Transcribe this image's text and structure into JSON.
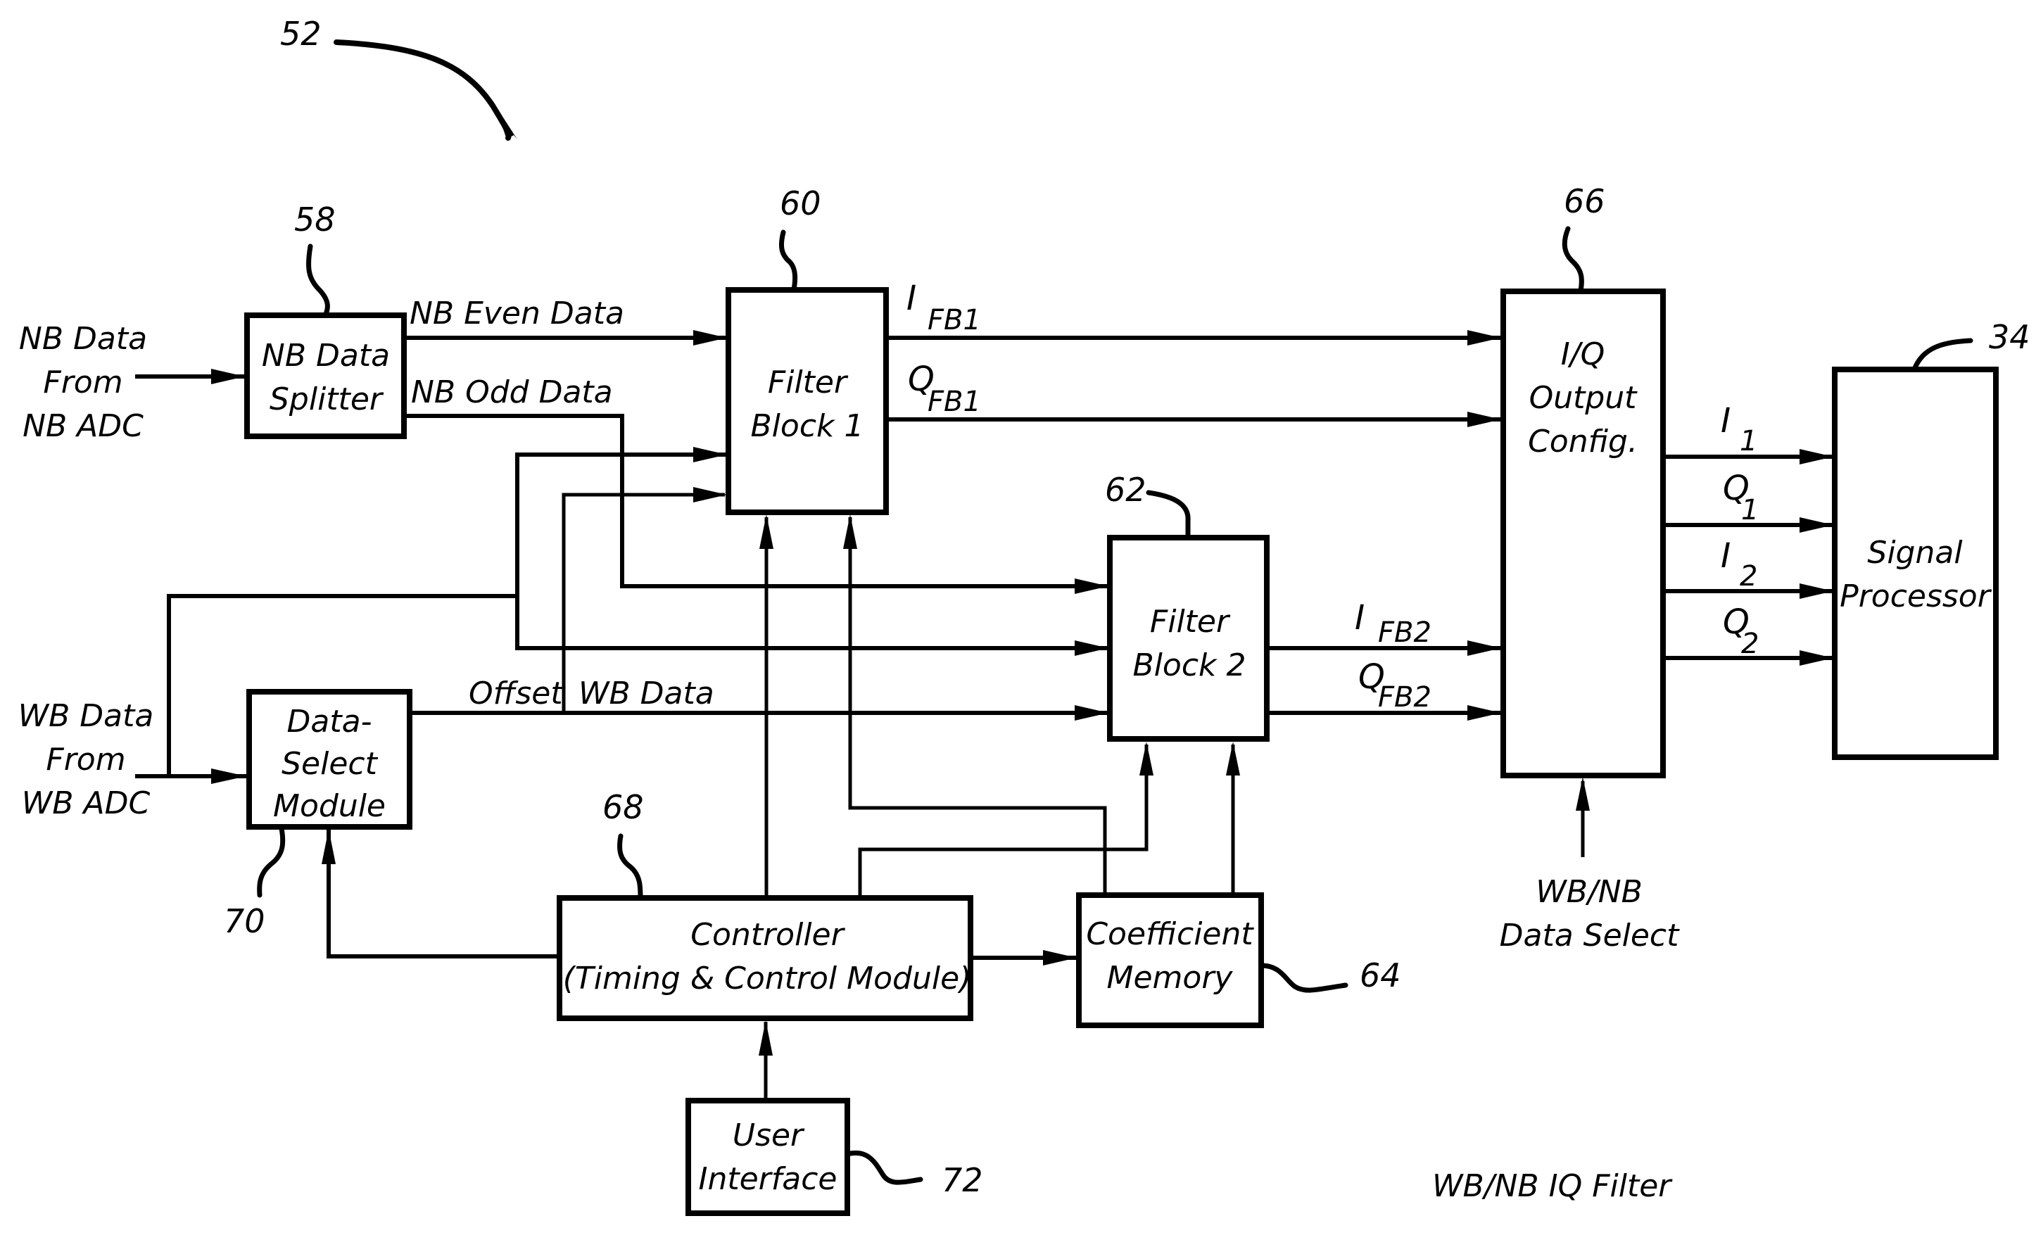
{
  "figure": {
    "reference_number": "52",
    "caption": "WB/NB IQ Filter"
  },
  "inputs": {
    "nb": {
      "lines": [
        "NB Data",
        "From",
        "NB ADC"
      ]
    },
    "wb": {
      "lines": [
        "WB Data",
        "From",
        "WB ADC"
      ]
    },
    "wbnb_select": {
      "lines": [
        "WB/NB",
        "Data Select"
      ]
    }
  },
  "blocks": {
    "nb_splitter": {
      "ref": "58",
      "lines": [
        "NB Data",
        "Splitter"
      ]
    },
    "filter_block_1": {
      "ref": "60",
      "lines": [
        "Filter",
        "Block 1"
      ]
    },
    "filter_block_2": {
      "ref": "62",
      "lines": [
        "Filter",
        "Block 2"
      ]
    },
    "coefficient_memory": {
      "ref": "64",
      "lines": [
        "Coefficient",
        "Memory"
      ]
    },
    "iq_output_config": {
      "ref": "66",
      "lines": [
        "I/Q",
        "Output",
        "Config."
      ]
    },
    "controller": {
      "ref": "68",
      "lines": [
        "Controller",
        "(Timing & Control Module)"
      ]
    },
    "data_select_module": {
      "ref": "70",
      "lines": [
        "Data-",
        "Select",
        "Module"
      ]
    },
    "user_interface": {
      "ref": "72",
      "lines": [
        "User",
        "Interface"
      ]
    },
    "signal_processor": {
      "ref": "34",
      "lines": [
        "Signal",
        "Processor"
      ]
    }
  },
  "signals": {
    "nb_even": "NB Even Data",
    "nb_odd": "NB Odd Data",
    "offset": "Offset",
    "wb_data": "WB Data",
    "i_fb1": {
      "main": "I",
      "sub": "FB1"
    },
    "q_fb1": {
      "main": "Q",
      "sub": "FB1"
    },
    "i_fb2": {
      "main": "I",
      "sub": "FB2"
    },
    "q_fb2": {
      "main": "Q",
      "sub": "FB2"
    },
    "i1": {
      "main": "I",
      "sub": "1"
    },
    "q1": {
      "main": "Q",
      "sub": "1"
    },
    "i2": {
      "main": "I",
      "sub": "2"
    },
    "q2": {
      "main": "Q",
      "sub": "2"
    }
  }
}
